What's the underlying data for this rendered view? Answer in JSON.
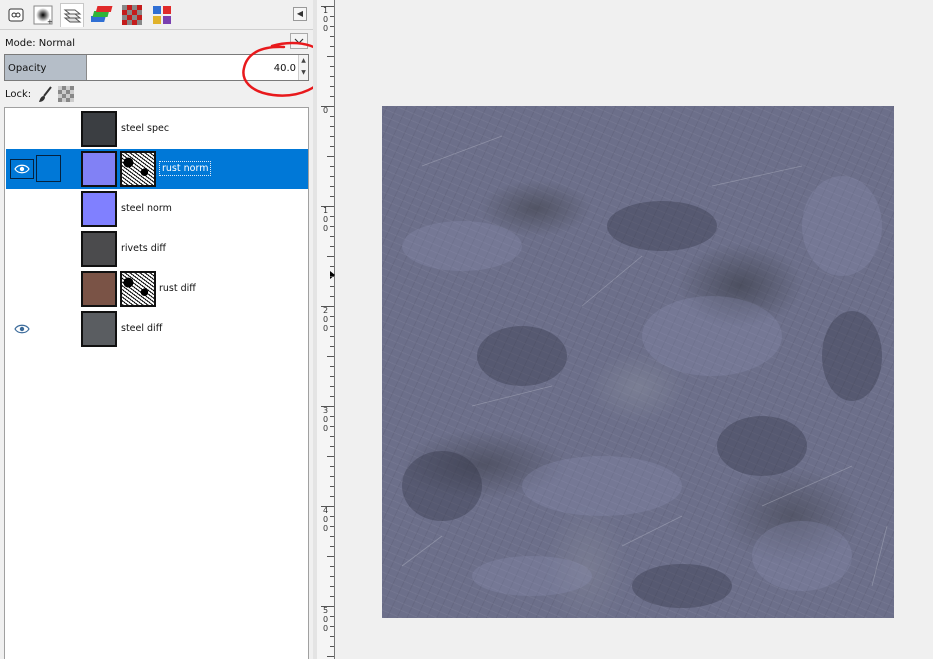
{
  "dock": {
    "tabs": [
      {
        "name": "tool-options-tab",
        "icon": "tool-options-icon"
      },
      {
        "name": "brushes-tab",
        "icon": "brush-icon"
      },
      {
        "name": "layers-tab",
        "icon": "layers-icon",
        "active": true
      },
      {
        "name": "channels-tab",
        "icon": "channels-icon"
      },
      {
        "name": "patterns-tab",
        "icon": "pattern-icon"
      },
      {
        "name": "colormap-tab",
        "icon": "palette-icon"
      }
    ],
    "menu_icon": "triangle-left-icon"
  },
  "layers_panel": {
    "mode_label": "Mode: Normal",
    "opacity_label": "Opacity",
    "opacity_value": "40.0",
    "opacity_fraction": 0.4,
    "lock_label": "Lock:",
    "layers": [
      {
        "name": "steel spec",
        "visible": false,
        "selected": false,
        "has_mask": false,
        "thumb_color": "#3b3e42"
      },
      {
        "name": "rust norm",
        "visible": true,
        "selected": true,
        "has_mask": true,
        "thumb_color": "#8181f5"
      },
      {
        "name": "steel norm",
        "visible": false,
        "selected": false,
        "has_mask": false,
        "thumb_color": "#8080ff"
      },
      {
        "name": "rivets diff",
        "visible": false,
        "selected": false,
        "has_mask": false,
        "thumb_color": "#4b4b4d"
      },
      {
        "name": "rust diff",
        "visible": false,
        "selected": false,
        "has_mask": true,
        "thumb_color": "#7a5346"
      },
      {
        "name": "steel diff",
        "visible": true,
        "selected": false,
        "has_mask": false,
        "thumb_color": "#5a5d61"
      }
    ]
  },
  "ruler": {
    "labels": [
      "100",
      "0",
      "100",
      "200",
      "300",
      "400",
      "500"
    ]
  },
  "colors": {
    "selection": "#0078d7",
    "annotation": "#e8191c",
    "opacity_fill": "#b5bec8"
  }
}
